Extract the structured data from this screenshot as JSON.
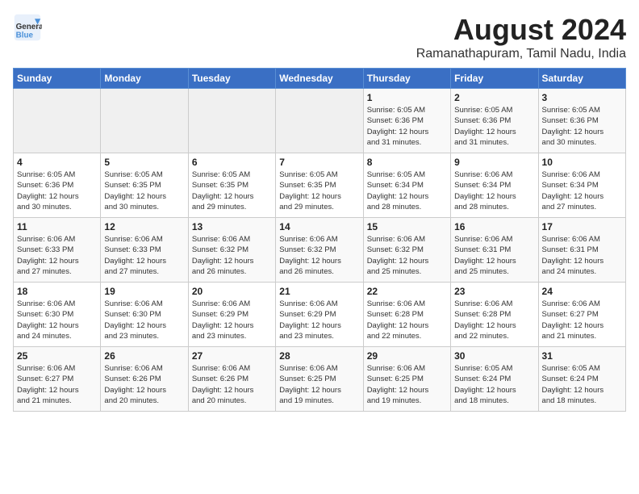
{
  "header": {
    "logo_line1": "General",
    "logo_line2": "Blue",
    "month_year": "August 2024",
    "location": "Ramanathapuram, Tamil Nadu, India"
  },
  "weekdays": [
    "Sunday",
    "Monday",
    "Tuesday",
    "Wednesday",
    "Thursday",
    "Friday",
    "Saturday"
  ],
  "weeks": [
    [
      {
        "day": "",
        "info": ""
      },
      {
        "day": "",
        "info": ""
      },
      {
        "day": "",
        "info": ""
      },
      {
        "day": "",
        "info": ""
      },
      {
        "day": "1",
        "info": "Sunrise: 6:05 AM\nSunset: 6:36 PM\nDaylight: 12 hours\nand 31 minutes."
      },
      {
        "day": "2",
        "info": "Sunrise: 6:05 AM\nSunset: 6:36 PM\nDaylight: 12 hours\nand 31 minutes."
      },
      {
        "day": "3",
        "info": "Sunrise: 6:05 AM\nSunset: 6:36 PM\nDaylight: 12 hours\nand 30 minutes."
      }
    ],
    [
      {
        "day": "4",
        "info": "Sunrise: 6:05 AM\nSunset: 6:36 PM\nDaylight: 12 hours\nand 30 minutes."
      },
      {
        "day": "5",
        "info": "Sunrise: 6:05 AM\nSunset: 6:35 PM\nDaylight: 12 hours\nand 30 minutes."
      },
      {
        "day": "6",
        "info": "Sunrise: 6:05 AM\nSunset: 6:35 PM\nDaylight: 12 hours\nand 29 minutes."
      },
      {
        "day": "7",
        "info": "Sunrise: 6:05 AM\nSunset: 6:35 PM\nDaylight: 12 hours\nand 29 minutes."
      },
      {
        "day": "8",
        "info": "Sunrise: 6:05 AM\nSunset: 6:34 PM\nDaylight: 12 hours\nand 28 minutes."
      },
      {
        "day": "9",
        "info": "Sunrise: 6:06 AM\nSunset: 6:34 PM\nDaylight: 12 hours\nand 28 minutes."
      },
      {
        "day": "10",
        "info": "Sunrise: 6:06 AM\nSunset: 6:34 PM\nDaylight: 12 hours\nand 27 minutes."
      }
    ],
    [
      {
        "day": "11",
        "info": "Sunrise: 6:06 AM\nSunset: 6:33 PM\nDaylight: 12 hours\nand 27 minutes."
      },
      {
        "day": "12",
        "info": "Sunrise: 6:06 AM\nSunset: 6:33 PM\nDaylight: 12 hours\nand 27 minutes."
      },
      {
        "day": "13",
        "info": "Sunrise: 6:06 AM\nSunset: 6:32 PM\nDaylight: 12 hours\nand 26 minutes."
      },
      {
        "day": "14",
        "info": "Sunrise: 6:06 AM\nSunset: 6:32 PM\nDaylight: 12 hours\nand 26 minutes."
      },
      {
        "day": "15",
        "info": "Sunrise: 6:06 AM\nSunset: 6:32 PM\nDaylight: 12 hours\nand 25 minutes."
      },
      {
        "day": "16",
        "info": "Sunrise: 6:06 AM\nSunset: 6:31 PM\nDaylight: 12 hours\nand 25 minutes."
      },
      {
        "day": "17",
        "info": "Sunrise: 6:06 AM\nSunset: 6:31 PM\nDaylight: 12 hours\nand 24 minutes."
      }
    ],
    [
      {
        "day": "18",
        "info": "Sunrise: 6:06 AM\nSunset: 6:30 PM\nDaylight: 12 hours\nand 24 minutes."
      },
      {
        "day": "19",
        "info": "Sunrise: 6:06 AM\nSunset: 6:30 PM\nDaylight: 12 hours\nand 23 minutes."
      },
      {
        "day": "20",
        "info": "Sunrise: 6:06 AM\nSunset: 6:29 PM\nDaylight: 12 hours\nand 23 minutes."
      },
      {
        "day": "21",
        "info": "Sunrise: 6:06 AM\nSunset: 6:29 PM\nDaylight: 12 hours\nand 23 minutes."
      },
      {
        "day": "22",
        "info": "Sunrise: 6:06 AM\nSunset: 6:28 PM\nDaylight: 12 hours\nand 22 minutes."
      },
      {
        "day": "23",
        "info": "Sunrise: 6:06 AM\nSunset: 6:28 PM\nDaylight: 12 hours\nand 22 minutes."
      },
      {
        "day": "24",
        "info": "Sunrise: 6:06 AM\nSunset: 6:27 PM\nDaylight: 12 hours\nand 21 minutes."
      }
    ],
    [
      {
        "day": "25",
        "info": "Sunrise: 6:06 AM\nSunset: 6:27 PM\nDaylight: 12 hours\nand 21 minutes."
      },
      {
        "day": "26",
        "info": "Sunrise: 6:06 AM\nSunset: 6:26 PM\nDaylight: 12 hours\nand 20 minutes."
      },
      {
        "day": "27",
        "info": "Sunrise: 6:06 AM\nSunset: 6:26 PM\nDaylight: 12 hours\nand 20 minutes."
      },
      {
        "day": "28",
        "info": "Sunrise: 6:06 AM\nSunset: 6:25 PM\nDaylight: 12 hours\nand 19 minutes."
      },
      {
        "day": "29",
        "info": "Sunrise: 6:06 AM\nSunset: 6:25 PM\nDaylight: 12 hours\nand 19 minutes."
      },
      {
        "day": "30",
        "info": "Sunrise: 6:05 AM\nSunset: 6:24 PM\nDaylight: 12 hours\nand 18 minutes."
      },
      {
        "day": "31",
        "info": "Sunrise: 6:05 AM\nSunset: 6:24 PM\nDaylight: 12 hours\nand 18 minutes."
      }
    ]
  ]
}
